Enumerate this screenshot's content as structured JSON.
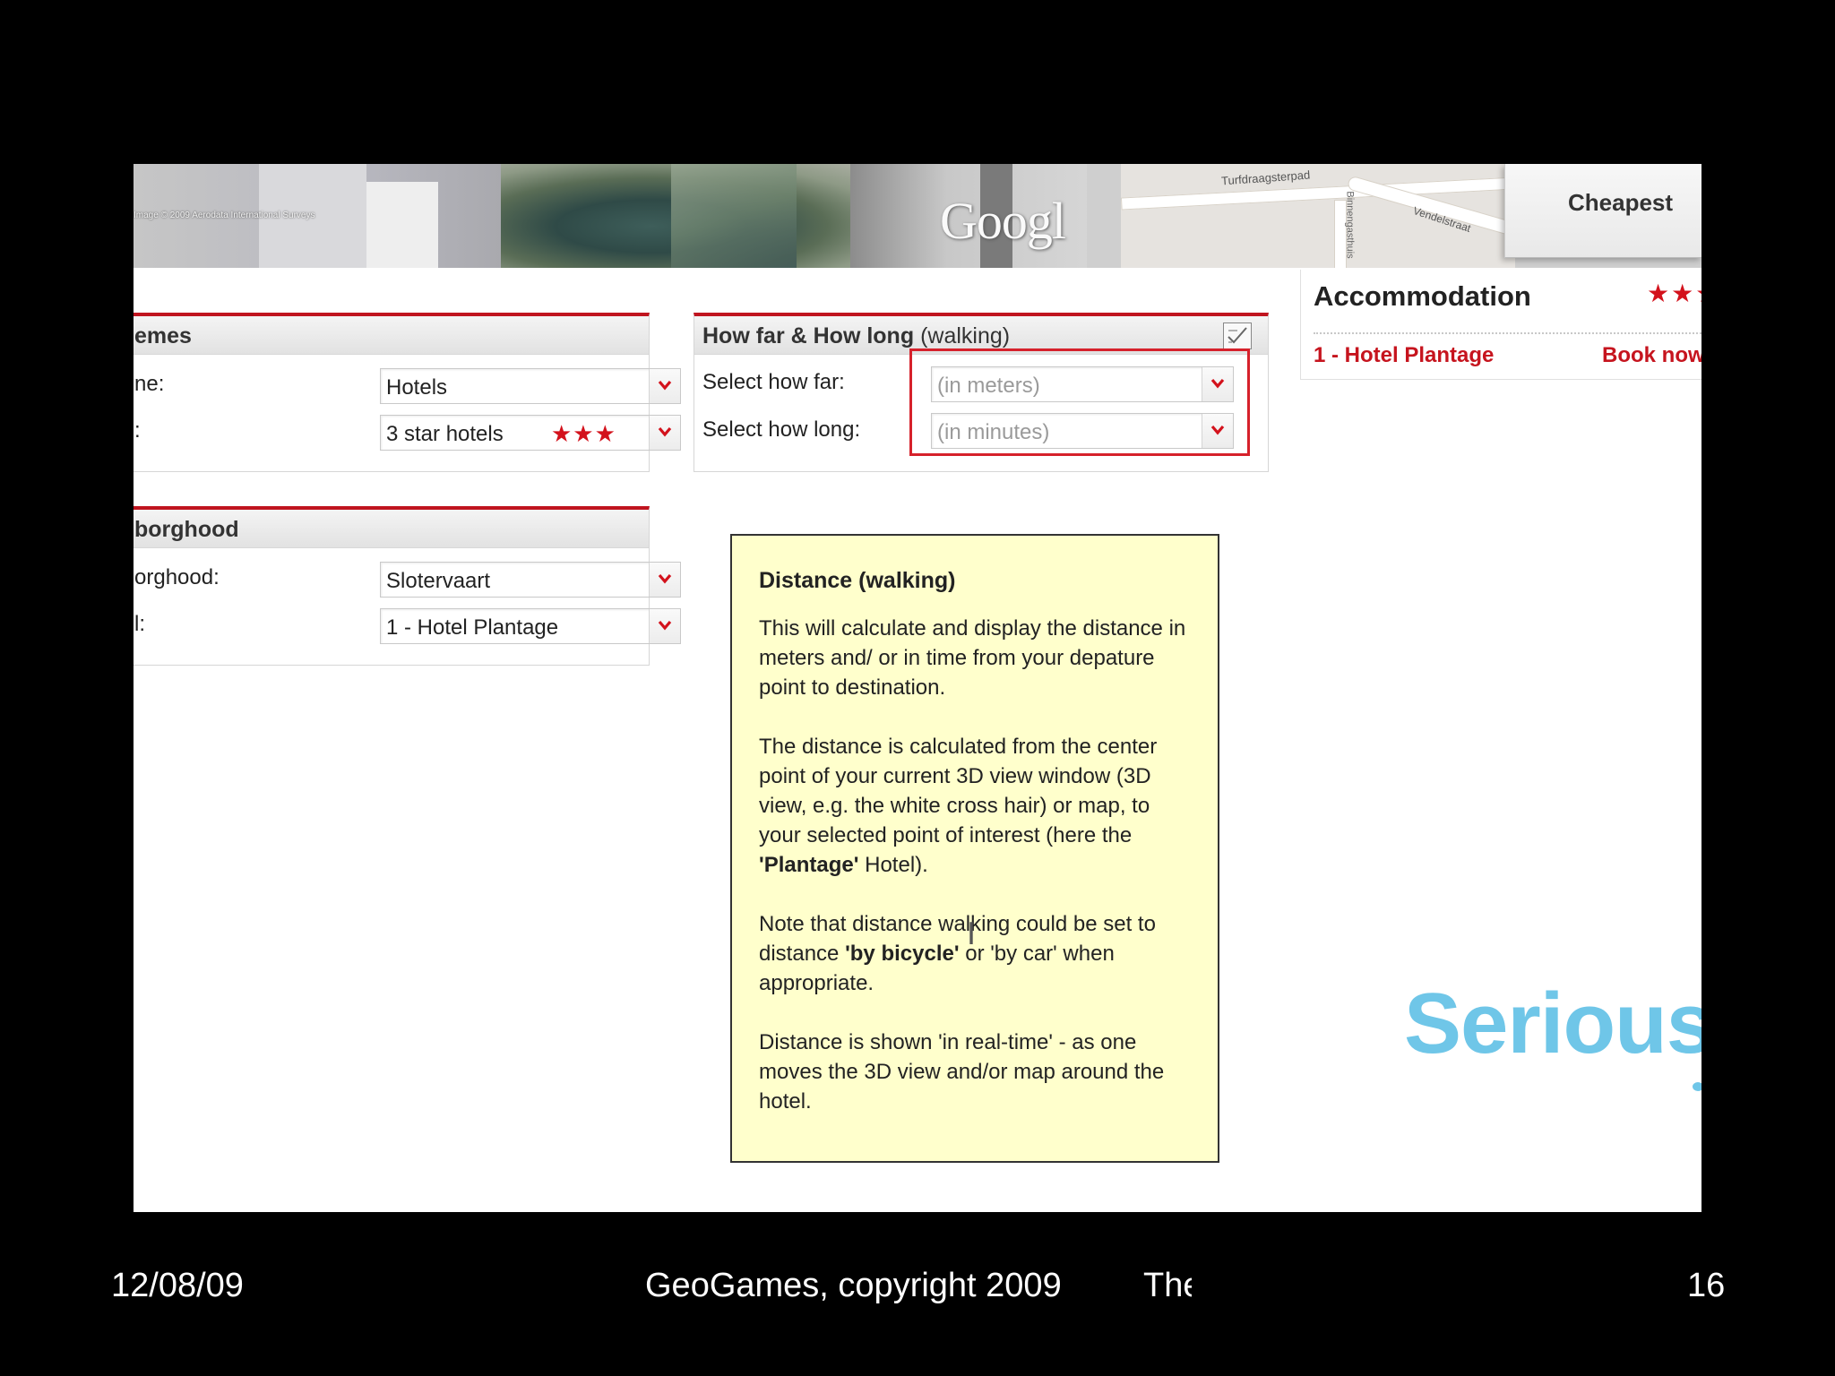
{
  "imagery": {
    "copyright_3d": "Image © 2009 Aerodata International Surveys",
    "google_logo": "Googl",
    "map_streets": [
      "Turfdraagsterpad",
      "Vendelstraat",
      "Binnengasthuis"
    ]
  },
  "cheapest_tab": {
    "label": "Cheapest"
  },
  "themes_panel": {
    "title": "emes",
    "row1_label": "ne:",
    "row1_value": "Hotels",
    "row2_label": ":",
    "row2_value": "3 star hotels",
    "row2_stars": "★★★"
  },
  "neighborhood_panel": {
    "title": "borghood",
    "row1_label": "orghood:",
    "row1_value": "Slotervaart",
    "row2_label": "l:",
    "row2_value": "1 - Hotel Plantage"
  },
  "distance_panel": {
    "title_bold": "How far & How long",
    "title_normal": "(walking)",
    "far_label": "Select how far:",
    "far_placeholder": "(in meters)",
    "long_label": "Select how long:",
    "long_placeholder": "(in minutes)"
  },
  "accommodation": {
    "title": "Accommodation",
    "stars": "★★★",
    "hotel": "1 - Hotel Plantage",
    "book": "Book now"
  },
  "tooltip": {
    "title": "Distance (walking)",
    "p1": "This will calculate and display the distance in meters and/ or in time from your depature point to destination.",
    "p2_a": "The distance is calculated from the center point of your current 3D view window (3D view, e.g. the white cross hair) or  map, to your selected point of interest (here the ",
    "p2_b": "'Plantage'",
    "p2_c": " Hotel).",
    "p3_a": "Note that distance walking could be set to distance ",
    "p3_b": "'by bicycle'",
    "p3_c": " or 'by car' when appropriate.",
    "p4": "Distance is shown 'in real-time' - as one moves the 3D view and/or map around the hotel."
  },
  "brand": {
    "text": "Serious"
  },
  "footer": {
    "date": "12/08/09",
    "copyright": "GeoGames, copyright 2009",
    "truncated": "The",
    "page": "16"
  },
  "colors": {
    "accent_red": "#c0141f",
    "tooltip_bg": "#ffffcc",
    "brand_blue": "#6fc6e8"
  }
}
